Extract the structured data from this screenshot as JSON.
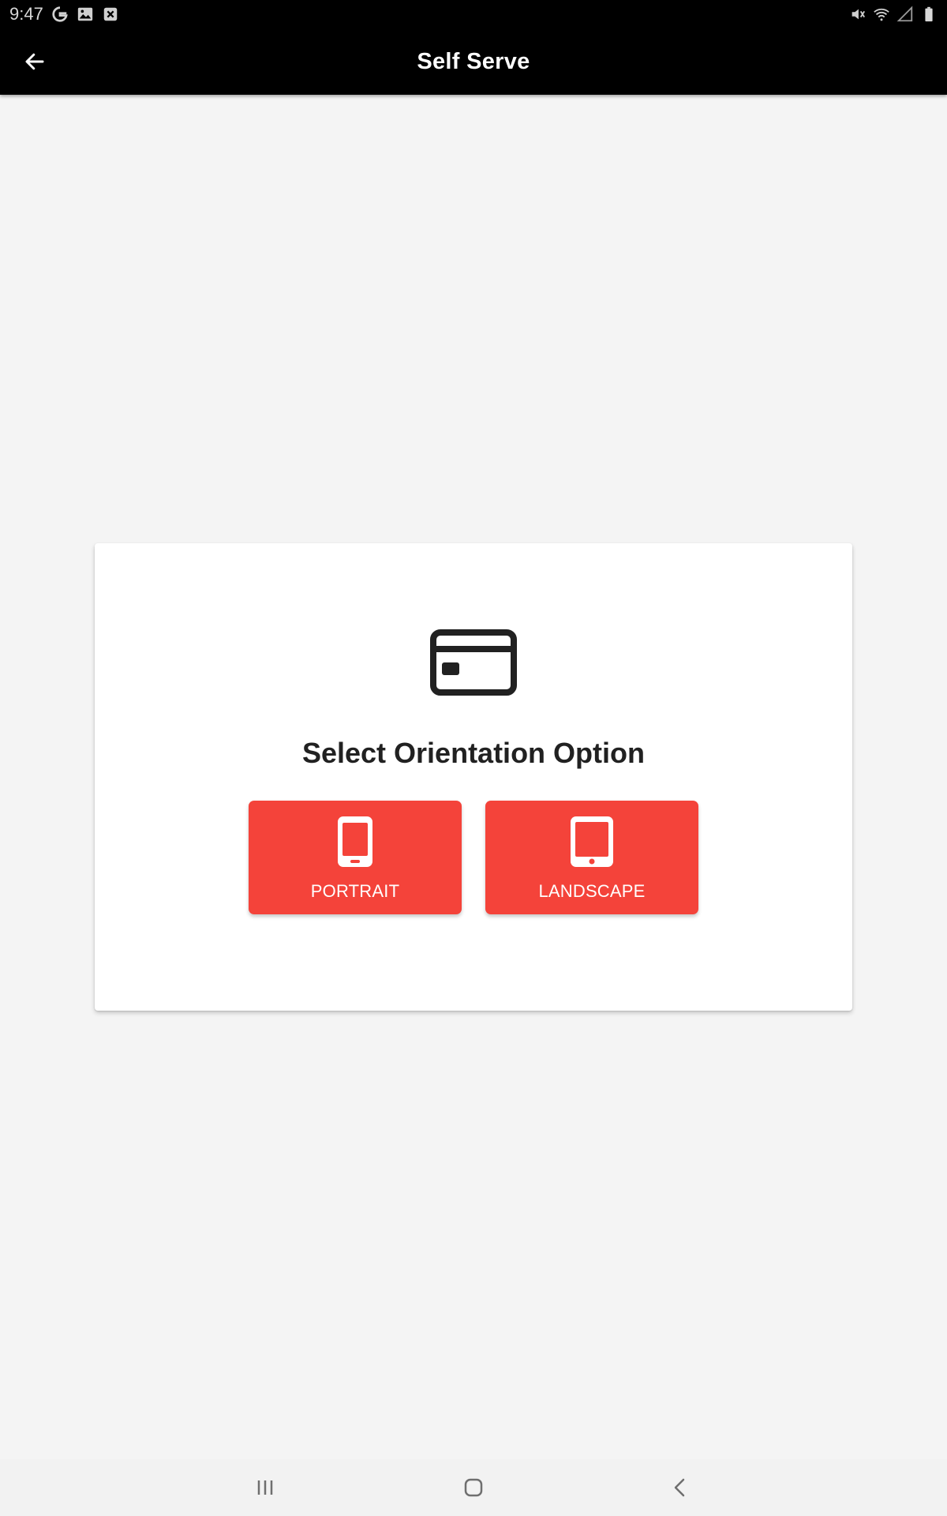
{
  "status_bar": {
    "time": "9:47",
    "left_icons": [
      "google-g-icon",
      "image-icon",
      "close-box-icon"
    ],
    "right_icons": [
      "mute-icon",
      "wifi-icon",
      "signal-icon",
      "battery-icon"
    ]
  },
  "app_bar": {
    "title": "Self Serve",
    "back_icon": "arrow-left-icon"
  },
  "card": {
    "icon": "credit-card-icon",
    "title": "Select Orientation Option",
    "options": [
      {
        "label": "PORTRAIT",
        "icon": "phone-portrait-icon"
      },
      {
        "label": "LANDSCAPE",
        "icon": "tablet-icon"
      }
    ]
  },
  "nav_bar": {
    "buttons": [
      "recents-icon",
      "home-icon",
      "back-chevron-icon"
    ]
  },
  "colors": {
    "accent": "#f4433a",
    "app_bar": "#000000",
    "background": "#f4f4f4",
    "card": "#ffffff",
    "title_text": "#212121"
  }
}
